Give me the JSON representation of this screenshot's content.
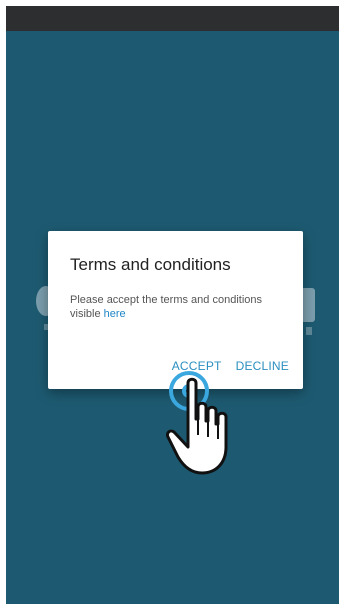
{
  "dialog": {
    "title": "Terms and conditions",
    "body_text": "Please accept the terms and conditions visible ",
    "link_text": "here",
    "accept_label": "ACCEPT",
    "decline_label": "DECLINE"
  },
  "colors": {
    "background": "#1d5a71",
    "status_bar": "#2c2e30",
    "accent": "#2b8fc0",
    "tap_ring": "#3ba7df"
  },
  "icons": {
    "pointer": "hand-pointer-icon",
    "tap": "tap-ripple-icon"
  }
}
